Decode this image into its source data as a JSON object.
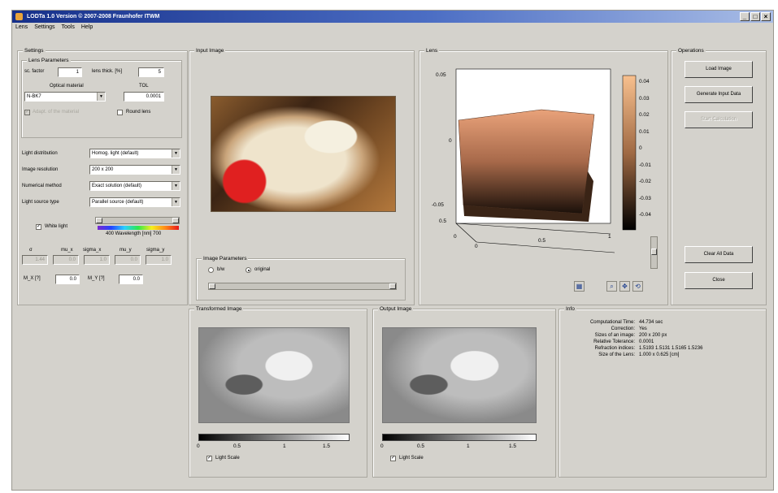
{
  "window": {
    "title": "LODTa 1.0 Version © 2007-2008 Fraunhofer ITWM",
    "controls": [
      "_",
      "□",
      "×"
    ]
  },
  "menu": [
    "Lens",
    "Settings",
    "Tools",
    "Help"
  ],
  "settings": {
    "title": "Settings",
    "lens_params": {
      "title": "Lens Parameters",
      "sc_factor_label": "sc. factor",
      "sc_factor": "1",
      "lens_thick_label": "lens thick. [%]",
      "lens_thick": "5"
    },
    "optical_material_label": "Optical material",
    "optical_material": "N-BK7",
    "tol_label": "TOL",
    "tol": "0.0001",
    "disabled_check_label": "Adapt. of the material",
    "round_lens_label": "Round lens",
    "light_distribution_label": "Light distribution",
    "light_distribution": "Homog. light (default)",
    "image_resolution_label": "Image resolution",
    "image_resolution": "200 x 200",
    "numerical_method_label": "Numerical method",
    "numerical_method": "Exact solution (default)",
    "light_source_label": "Light source type",
    "light_source": "Parallel source (default)",
    "white_light_label": "White light",
    "wavelength_label": "400  Wavelength [nm]  700",
    "param_headers": [
      "σ",
      "mu_x",
      "sigma_x",
      "mu_y",
      "sigma_y"
    ],
    "param_values": [
      "1.44",
      "0.0",
      "1.0",
      "0.0",
      "1.0"
    ],
    "mxy_label": "M_X [?]",
    "mxy_value": "0.0",
    "myy_label": "M_Y [?]",
    "myy_value": "0.0"
  },
  "input_image": {
    "title": "Input Image",
    "params_title": "Image Parameters",
    "radio_bw": "b/w",
    "radio_original": "original"
  },
  "lens": {
    "title": "Lens",
    "z_ticks": [
      "0.05",
      "0",
      "-0.05"
    ],
    "y_ticks": [
      "0.5",
      "0"
    ],
    "x_ticks": [
      "0",
      "0.5",
      "1"
    ],
    "colorbar_ticks": [
      "0.04",
      "0.03",
      "0.02",
      "0.01",
      "0",
      "-0.01",
      "-0.02",
      "-0.03",
      "-0.04"
    ]
  },
  "operations": {
    "title": "Operations",
    "load_image": "Load Image",
    "generate_input": "Generate Input Data",
    "disabled_button": "Start Calculation",
    "clear_all": "Clear All Data",
    "close": "Close"
  },
  "transformed": {
    "title": "Transformed Image",
    "scale_ticks": [
      "0",
      "0.5",
      "1",
      "1.5"
    ],
    "light_scale": "Light Scale"
  },
  "output": {
    "title": "Output Image",
    "scale_ticks": [
      "0",
      "0.5",
      "1",
      "1.5"
    ],
    "light_scale": "Light Scale"
  },
  "info": {
    "title": "Info",
    "rows": [
      {
        "label": "Computational Time:",
        "value": "44.734 sec"
      },
      {
        "label": "Correction:",
        "value": "Yes"
      },
      {
        "label": "Sizes of an image:",
        "value": "200 x 200 px"
      },
      {
        "label": "Relative Tolerance:",
        "value": "0.0001"
      },
      {
        "label": "Refraction indices:",
        "value": "1.5193    1.5131    1.5165    1.5236"
      },
      {
        "label": "Size of the Lens:",
        "value": "1.000 x 0.625   [cm]"
      }
    ]
  }
}
